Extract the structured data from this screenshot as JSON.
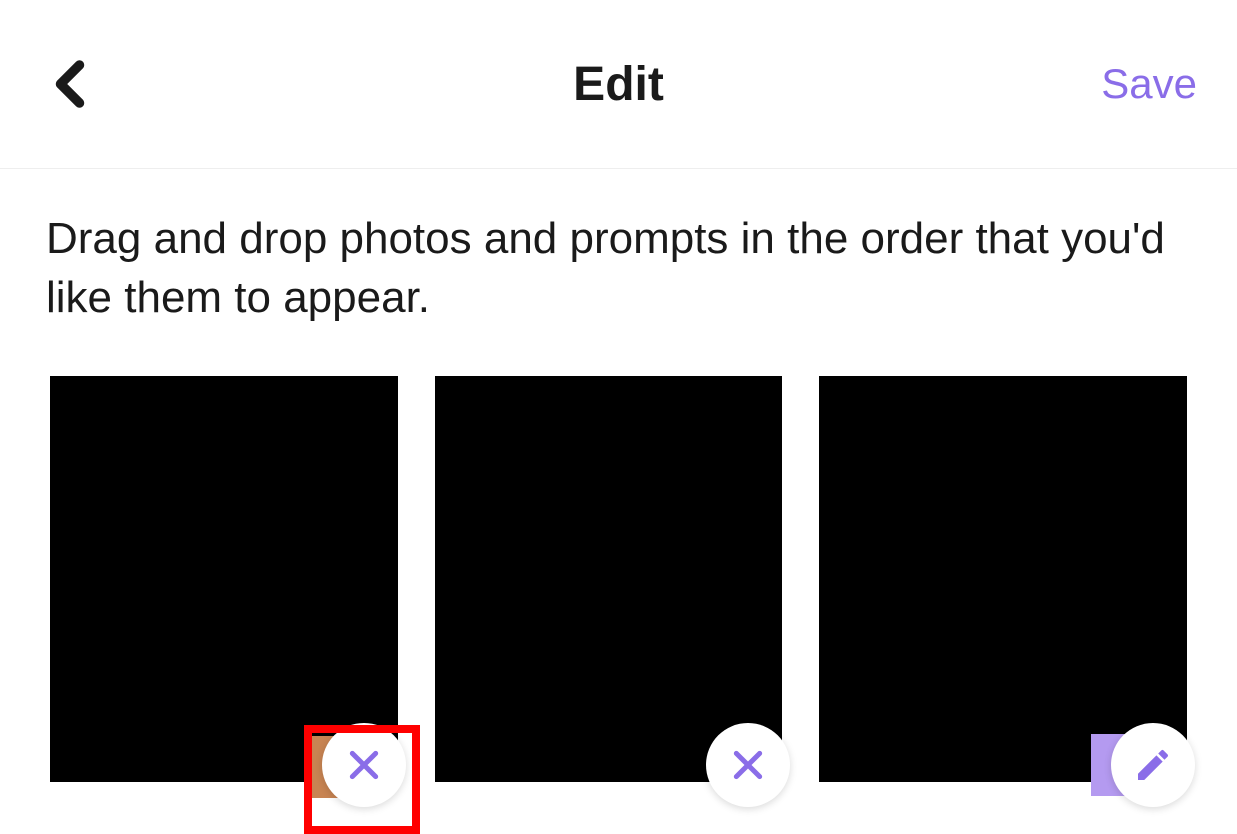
{
  "header": {
    "title": "Edit",
    "save_label": "Save"
  },
  "instruction": "Drag and drop photos and prompts in the order that you'd like them to appear.",
  "photos": [
    {
      "action": "remove",
      "highlighted": true
    },
    {
      "action": "remove",
      "highlighted": false
    },
    {
      "action": "edit",
      "highlighted": false
    }
  ],
  "colors": {
    "accent": "#8a6de8",
    "highlight": "#ff0000"
  }
}
